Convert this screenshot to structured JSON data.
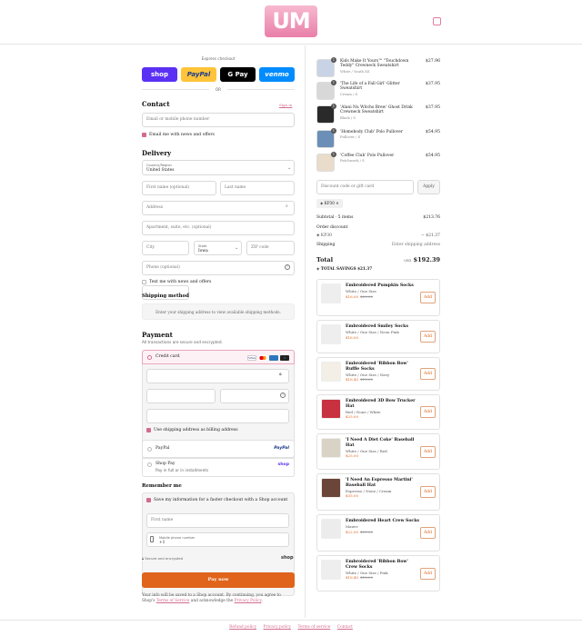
{
  "header": {
    "logo": "UM",
    "bag_icon": "bag-icon"
  },
  "express": {
    "title": "Express checkout",
    "or": "OR",
    "buttons": [
      {
        "label": "shop",
        "color": "#5a31f4"
      },
      {
        "label": "PayPal",
        "color": "#ffc439"
      },
      {
        "label": "G Pay",
        "color": "#000000"
      },
      {
        "label": "venmo",
        "color": "#008cff"
      }
    ]
  },
  "contact": {
    "title": "Contact",
    "signin": "Sign in",
    "email_placeholder": "Email or mobile phone number",
    "news_label": "Email me with news and offers"
  },
  "delivery": {
    "title": "Delivery",
    "country_label": "Country/Region",
    "country": "United States",
    "first_name": "First name (optional)",
    "last_name": "Last name",
    "address": "Address",
    "apartment": "Apartment, suite, etc. (optional)",
    "city": "City",
    "state_label": "State",
    "state": "Iowa",
    "zip": "ZIP code",
    "phone": "Phone (optional)",
    "text_label": "Text me with news and offers"
  },
  "shipping": {
    "title": "Shipping method",
    "message": "Enter your shipping address to view available shipping methods."
  },
  "payment": {
    "title": "Payment",
    "subtitle": "All transactions are secure and encrypted.",
    "credit_card": "Credit card",
    "billing_same": "Use shipping address as billing address",
    "paypal": "PayPal",
    "paypal_logo": "PayPal",
    "shoppay": "Shop Pay",
    "shoppay_sub": "Pay in full or in installments",
    "shoppay_logo": "shop"
  },
  "remember": {
    "title": "Remember me",
    "save_label": "Save my information for a faster checkout with a Shop account",
    "first_name": "First name",
    "phone_label": "Mobile phone number",
    "phone_value": "+1",
    "secure": "Secure and encrypted",
    "shop": "shop"
  },
  "pay_now": "Pay now",
  "legal": {
    "text1": "Your info will be saved to a Shop account. By continuing, you agree to Shop's ",
    "terms": "Terms of Service",
    "text2": " and acknowledge the ",
    "privacy": "Privacy Policy",
    "text3": "."
  },
  "footer": {
    "links": [
      "Refund policy",
      "Privacy policy",
      "Terms of service",
      "Contact"
    ]
  },
  "cart": {
    "items": [
      {
        "qty": "1",
        "name": "Kids Make It Yours™ \"Touchdown Teddy\" Crewneck Sweatshirt",
        "variant": "White / Youth XS",
        "price": "$27.96"
      },
      {
        "qty": "1",
        "name": "'The Life of a Fall Girl' Glitter Sweatshirt",
        "variant": "Cream / S",
        "price": "$37.95"
      },
      {
        "qty": "1",
        "name": "'Alani Nu Witchs Brew' Ghost Drink Crewneck Sweatshirt",
        "variant": "Black / S",
        "price": "$37.95"
      },
      {
        "qty": "1",
        "name": "'Homebody Club' Polo Pullover",
        "variant": "Pullover / S",
        "price": "$54.95"
      },
      {
        "qty": "1",
        "name": "'Coffee Club' Polo Pullover",
        "variant": "Patchwork / S",
        "price": "$54.95"
      }
    ],
    "discount_placeholder": "Discount code or gift card",
    "apply": "Apply",
    "code": "KP30",
    "subtotal_label": "Subtotal · 5 items",
    "subtotal": "$213.76",
    "order_discount": "Order discount",
    "discount_code": "KP30",
    "discount_value": "− $21.37",
    "shipping_label": "Shipping",
    "shipping_value": "Enter shipping address",
    "total_label": "Total",
    "currency": "USD",
    "total": "$192.39",
    "savings_label": "TOTAL SAVINGS",
    "savings": "$21.37"
  },
  "upsells": [
    {
      "name": "Embroidered Pumpkin Socks",
      "variant": "White / One Size",
      "price": "$16.00",
      "old": "$20.00",
      "add": "Add",
      "color": "#eeeeee"
    },
    {
      "name": "Embroidered Smiley Socks",
      "variant": "White / One Size / Neon Pink",
      "price": "$16.00",
      "old": "",
      "add": "Add",
      "color": "#eeeeee"
    },
    {
      "name": "Embroidered 'Ribbon Bow' Ruffle Socks",
      "variant": "White / One Size / Navy",
      "price": "$16.40",
      "old": "$18.00",
      "add": "Add",
      "color": "#f3eee6"
    },
    {
      "name": "Embroidered 3D Bow Trucker Hat",
      "variant": "Red / None / White",
      "price": "$25.00",
      "old": "",
      "add": "Add",
      "color": "#c8313f"
    },
    {
      "name": "'I Need A Diet Coke' Baseball Hat",
      "variant": "White / One Size / Red",
      "price": "$25.00",
      "old": "",
      "add": "Add",
      "color": "#d9d3c5"
    },
    {
      "name": "'I Need An Espresso Martini' Baseball Hat",
      "variant": "Espresso / None / Cream",
      "price": "$35.00",
      "old": "",
      "add": "Add",
      "color": "#6b4538"
    },
    {
      "name": "Embroidered Heart Crew Socks",
      "variant": "Mauve",
      "price": "$22.00",
      "old": "$25.00",
      "add": "Add",
      "color": "#ececec"
    },
    {
      "name": "Embroidered 'Ribbon Bow' Crew Socks",
      "variant": "White / One Size / Pink",
      "price": "$16.40",
      "old": "$18.00",
      "add": "Add",
      "color": "#eeeeee"
    }
  ]
}
